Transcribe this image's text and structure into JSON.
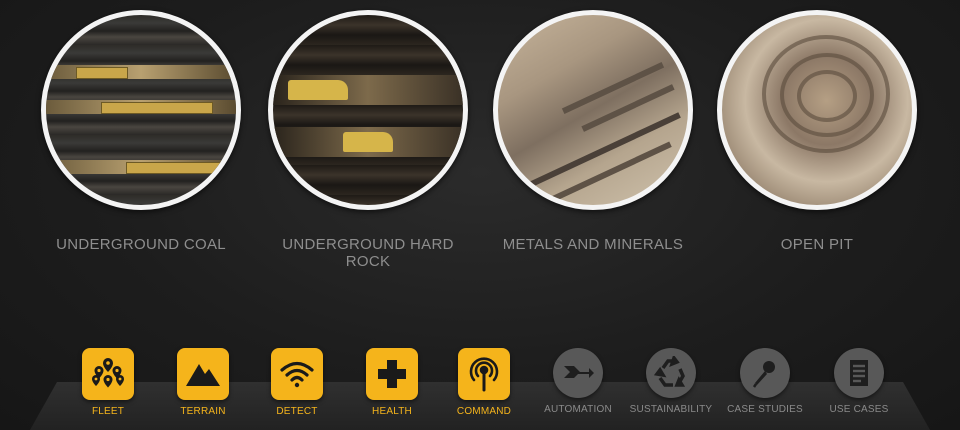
{
  "mines": [
    {
      "label": "UNDERGROUND COAL"
    },
    {
      "label": "UNDERGROUND HARD ROCK"
    },
    {
      "label": "METALS AND MINERALS"
    },
    {
      "label": "OPEN PIT"
    }
  ],
  "nav": [
    {
      "label": "FLEET",
      "icon": "map-pins-icon",
      "active": true
    },
    {
      "label": "TERRAIN",
      "icon": "mountain-icon",
      "active": true
    },
    {
      "label": "DETECT",
      "icon": "wifi-signal-icon",
      "active": true
    },
    {
      "label": "HEALTH",
      "icon": "plus-cross-icon",
      "active": true
    },
    {
      "label": "COMMAND",
      "icon": "broadcast-tower-icon",
      "active": true
    },
    {
      "label": "AUTOMATION",
      "icon": "merge-arrows-icon",
      "active": false
    },
    {
      "label": "SUSTAINABILITY",
      "icon": "recycle-icon",
      "active": false
    },
    {
      "label": "CASE STUDIES",
      "icon": "microphone-icon",
      "active": false
    },
    {
      "label": "USE CASES",
      "icon": "document-list-icon",
      "active": false
    }
  ],
  "colors": {
    "accent": "#f5b41b",
    "muted": "#585858",
    "label": "#8e8e8e"
  }
}
